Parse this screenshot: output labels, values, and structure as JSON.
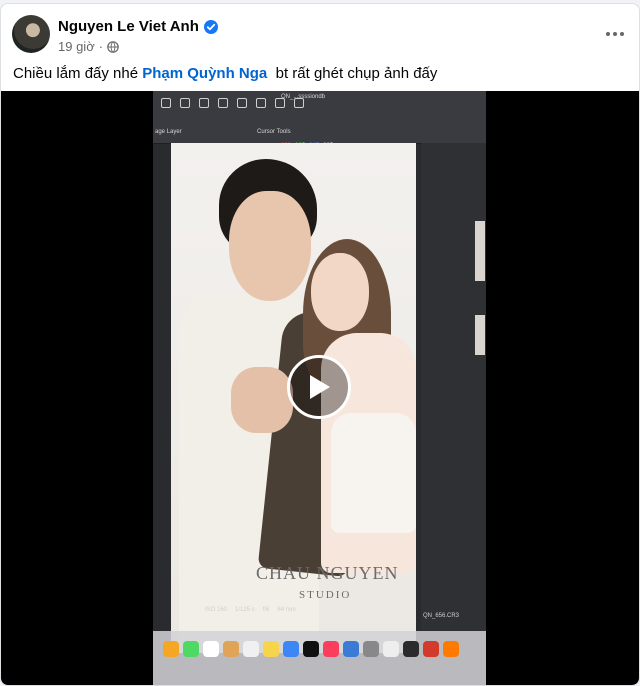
{
  "post": {
    "author_name": "Nguyen Le Viet Anh",
    "timestamp": "19 giờ",
    "separator": "·",
    "text_before_mention": "Chiều lắm đấy nhé ",
    "mention": "Phạm Quỳnh Nga",
    "text_after_mention": "  bt rất ghét chụp ảnh đấy"
  },
  "video": {
    "screen": {
      "filename": "QN_...ssssiondb",
      "layer_label": "age Layer",
      "cursor_label": "Cursor Tools",
      "rgb_values": [
        "230",
        "225",
        "215",
        "225"
      ],
      "watermark_line1": "CHAU NGUYEN",
      "watermark_line2": "STUDIO",
      "exif_values": [
        "ISO 160",
        "1/125 s",
        "f/6",
        "84 mm"
      ],
      "file_label": "QN_656.CR3"
    }
  },
  "colors": {
    "mention": "#0064d1",
    "verified": "#1877f2",
    "rgb_red": "#ff6b6b",
    "rgb_green": "#6bdc6b",
    "rgb_blue": "#6b9cff",
    "rgb_white": "#dddddd"
  },
  "icons": {
    "verified": "verified-badge-icon",
    "audience": "globe-icon",
    "more": "more-options-icon",
    "play": "play-icon"
  }
}
